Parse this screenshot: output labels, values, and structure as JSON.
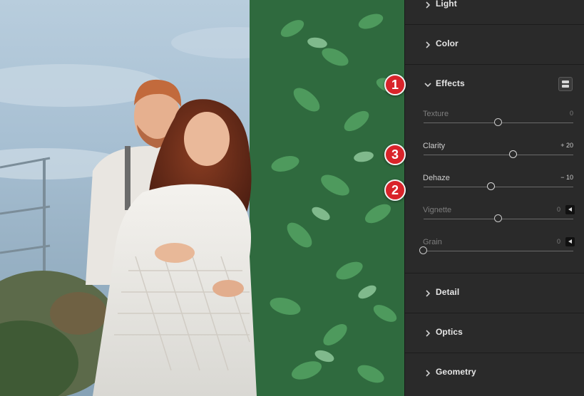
{
  "panel": {
    "sections": {
      "light": {
        "label": "Light"
      },
      "color": {
        "label": "Color"
      },
      "effects": {
        "label": "Effects"
      },
      "detail": {
        "label": "Detail"
      },
      "optics": {
        "label": "Optics"
      },
      "geometry": {
        "label": "Geometry"
      }
    },
    "effects": {
      "texture": {
        "label": "Texture",
        "value": "0",
        "level": 0.5
      },
      "clarity": {
        "label": "Clarity",
        "value": "+ 20",
        "level": 0.6
      },
      "dehaze": {
        "label": "Dehaze",
        "value": "− 10",
        "level": 0.45
      },
      "vignette": {
        "label": "Vignette",
        "value": "0",
        "level": 0.5
      },
      "grain": {
        "label": "Grain",
        "value": "0",
        "level": 0.0
      }
    }
  },
  "badges": [
    "1",
    "3",
    "2"
  ],
  "colors": {
    "panel_bg": "#2a2a2a",
    "badge_red": "#d9232a",
    "text": "#e6e6e6"
  },
  "icons": [
    "chevron-right-icon",
    "chevron-down-icon",
    "split-view-icon",
    "triangle-left-icon"
  ]
}
